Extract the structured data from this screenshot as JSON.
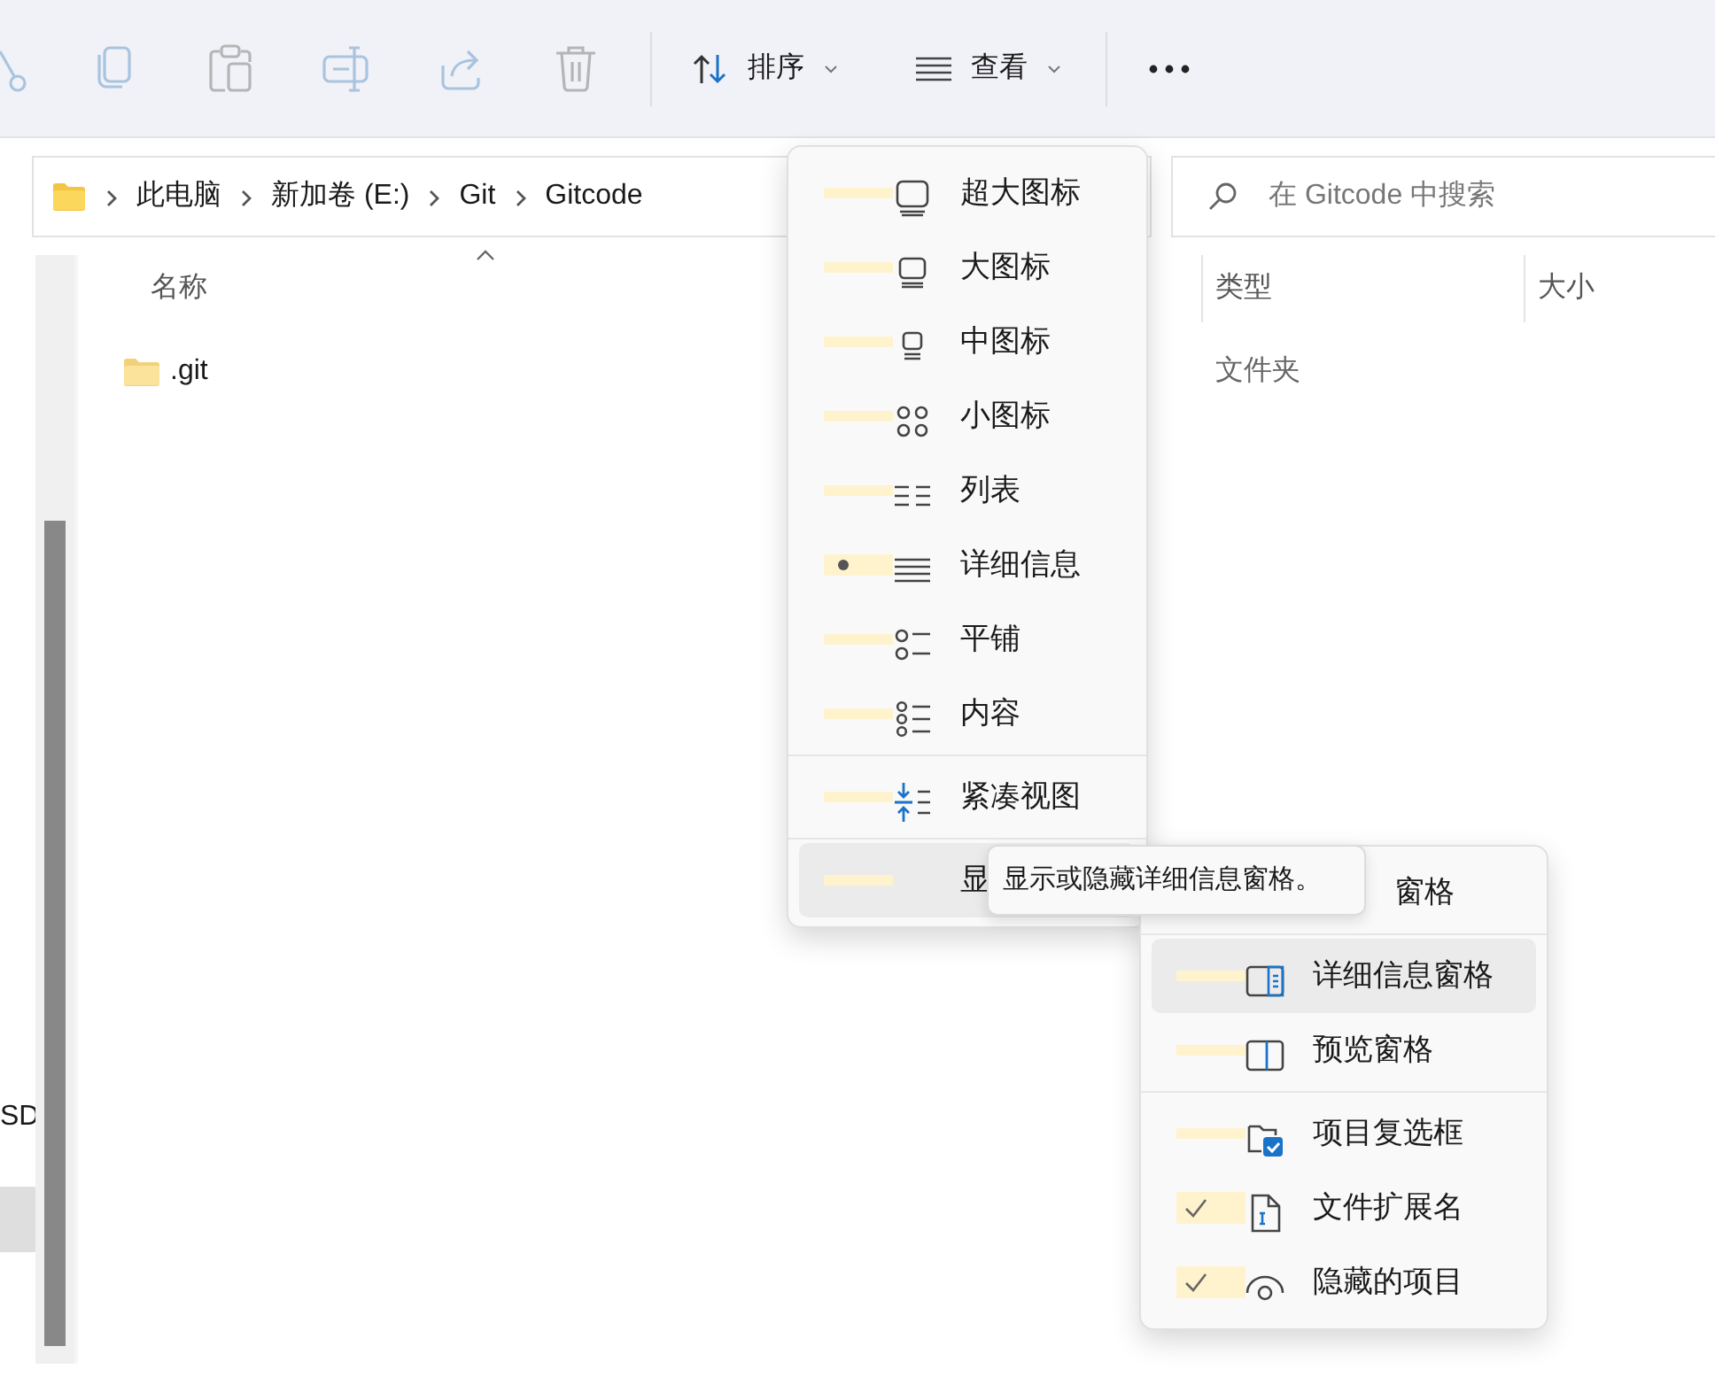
{
  "toolbar": {
    "actions": [
      {
        "kind": "cut",
        "disabled": true
      },
      {
        "kind": "copy",
        "disabled": true
      },
      {
        "kind": "paste",
        "disabled": true
      },
      {
        "kind": "rename",
        "disabled": true
      },
      {
        "kind": "share",
        "disabled": true
      },
      {
        "kind": "delete",
        "disabled": true
      }
    ],
    "sort_button": {
      "label": "排序"
    },
    "view_button": {
      "label": "查看"
    }
  },
  "address_bar": {
    "crumbs": [
      "此电脑",
      "新加卷 (E:)",
      "Git",
      "Gitcode"
    ]
  },
  "search": {
    "placeholder": "在 Gitcode 中搜索"
  },
  "nav_pane": {
    "items": [
      {
        "label": "SD",
        "selected": false
      },
      {
        "selected": true
      }
    ]
  },
  "columns": [
    {
      "label": "名称",
      "sorted": true
    },
    {
      "label": "类型",
      "sorted": false
    },
    {
      "label": "大小",
      "sorted": false
    }
  ],
  "rows": [
    {
      "name": ".git",
      "type": "文件夹"
    }
  ],
  "view_menu": {
    "sections": [
      {
        "items": [
          {
            "label": "超大图标",
            "selected": false
          },
          {
            "label": "大图标",
            "selected": false
          },
          {
            "label": "中图标",
            "selected": false
          },
          {
            "label": "小图标",
            "selected": false
          },
          {
            "label": "列表",
            "selected": false
          },
          {
            "label": "详细信息",
            "selected": true
          },
          {
            "label": "平铺",
            "selected": false
          },
          {
            "label": "内容",
            "selected": false
          }
        ]
      },
      {
        "items": [
          {
            "label": "紧凑视图",
            "checked": false,
            "highlighted": false
          }
        ]
      },
      {
        "items": [
          {
            "label": "显",
            "highlighted": true
          }
        ]
      }
    ]
  },
  "sub_menu": {
    "sections": [
      {
        "items": [
          {
            "label": "窗格",
            "highlighted": false
          }
        ]
      },
      {
        "items": [
          {
            "label": "详细信息窗格",
            "highlighted": true
          },
          {
            "label": "预览窗格",
            "highlighted": false
          }
        ]
      },
      {
        "items": [
          {
            "label": "项目复选框",
            "checked": false
          },
          {
            "label": "文件扩展名",
            "checked": true
          },
          {
            "label": "隐藏的项目",
            "checked": true
          }
        ]
      }
    ]
  },
  "tooltip": {
    "text": "显示或隐藏详细信息窗格。"
  }
}
